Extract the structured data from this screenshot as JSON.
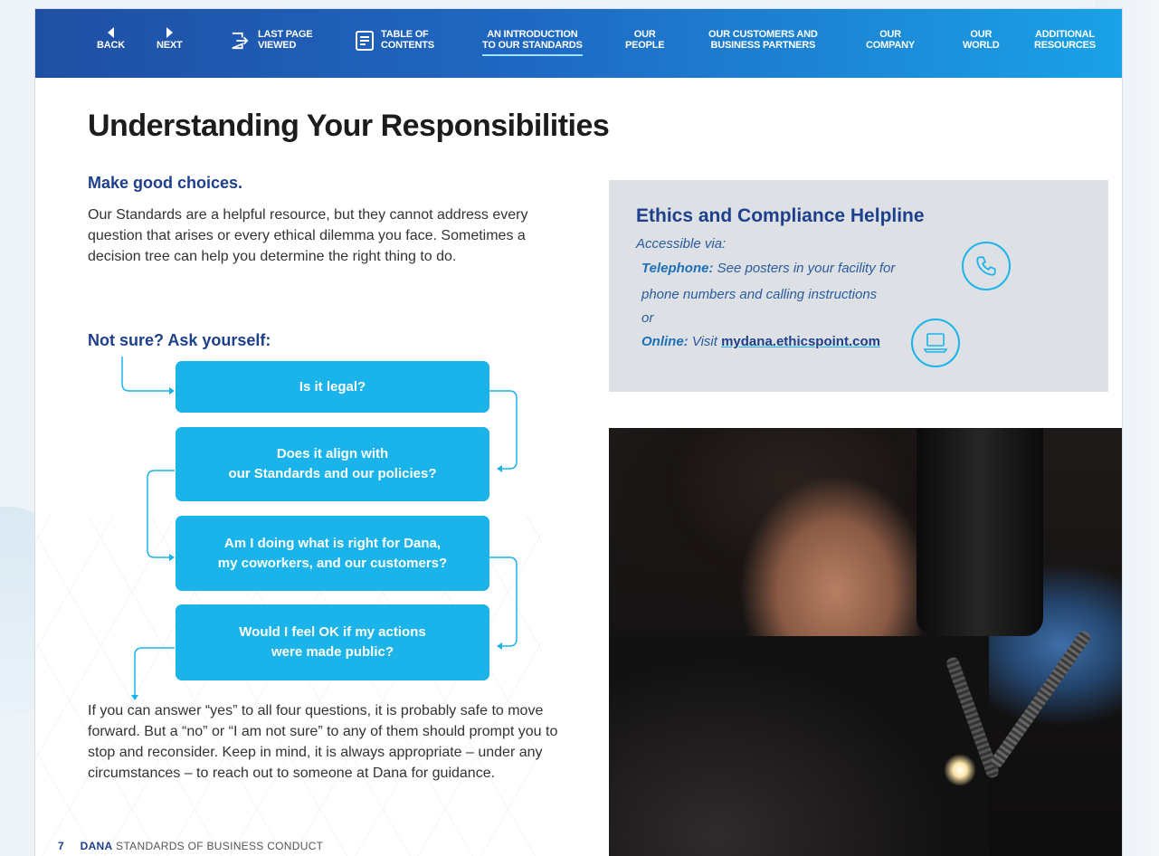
{
  "nav": {
    "back": "BACK",
    "next": "NEXT",
    "last_page_1": "LAST PAGE",
    "last_page_2": "VIEWED",
    "toc_1": "TABLE OF",
    "toc_2": "CONTENTS",
    "intro_1": "AN INTRODUCTION",
    "intro_2": "TO OUR STANDARDS",
    "people_1": "OUR",
    "people_2": "PEOPLE",
    "customers_1": "OUR CUSTOMERS AND",
    "customers_2": "BUSINESS PARTNERS",
    "company_1": "OUR",
    "company_2": "COMPANY",
    "world_1": "OUR",
    "world_2": "WORLD",
    "resources_1": "ADDITIONAL",
    "resources_2": "RESOURCES"
  },
  "page": {
    "title": "Understanding Your Responsibilities",
    "make_choices_heading": "Make good choices.",
    "make_choices_text": "Our Standards are a helpful resource, but they cannot address every question that arises or every ethical dilemma you face. Sometimes a decision tree can help you determine the right thing to do.",
    "not_sure_heading": "Not sure? Ask yourself:",
    "questions": [
      "Is it legal?",
      "Does it align with our Standards and our policies?",
      "Am I doing what is right for Dana, my coworkers, and our customers?",
      "Would I feel OK if my actions were made public?"
    ],
    "question_lines": [
      [
        "Is it legal?"
      ],
      [
        "Does it align with",
        "our Standards and our policies?"
      ],
      [
        "Am I doing what is right for Dana,",
        "my coworkers, and our customers?"
      ],
      [
        "Would I feel OK if my actions",
        "were made public?"
      ]
    ],
    "closing_text": "If you can answer “yes” to all four questions, it is probably safe to move forward. But a “no” or “I am not sure” to any of them should prompt you to stop and reconsider. Keep in mind, it is always appropriate – under any circumstances – to reach out to someone at Dana for guidance."
  },
  "helpline": {
    "title": "Ethics and Compliance Helpline",
    "accessible": "Accessible via:",
    "telephone_label": "Telephone:",
    "telephone_text_1": "See posters in your facility for",
    "telephone_text_2": "phone numbers and calling instructions",
    "or": "or",
    "online_label": "Online:",
    "online_text": "Visit",
    "online_link": "mydana.ethicspoint.com"
  },
  "footer": {
    "page_number": "7",
    "brand": "DANA",
    "doc_title": "STANDARDS OF BUSINESS CONDUCT"
  },
  "colors": {
    "nav_start": "#1f4fa3",
    "nav_end": "#1aa2e6",
    "flow_box": "#1ab4ea",
    "heading_blue": "#1e3f8a",
    "helpline_bg": "#dde1e5"
  }
}
